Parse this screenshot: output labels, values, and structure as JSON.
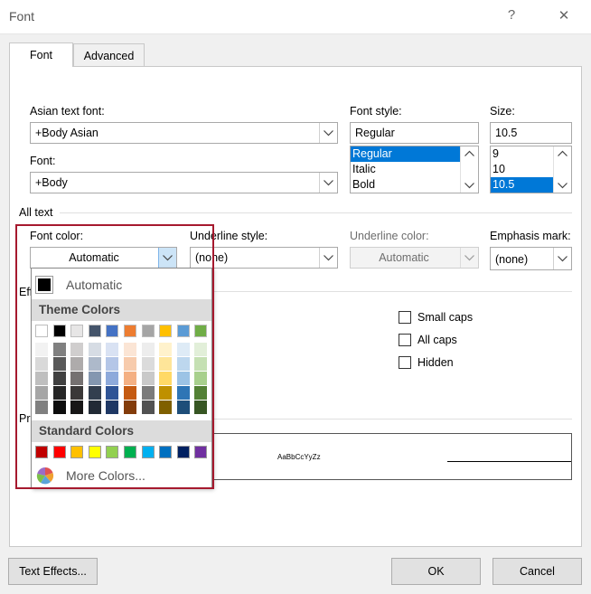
{
  "window": {
    "title": "Font",
    "help": "?",
    "close": "✕"
  },
  "tabs": [
    {
      "label": "Font",
      "active": true
    },
    {
      "label": "Advanced",
      "active": false
    }
  ],
  "asian_font": {
    "label": "Asian text font:",
    "value": "+Body Asian"
  },
  "font": {
    "label": "Font:",
    "value": "+Body"
  },
  "font_style": {
    "label": "Font style:",
    "value": "Regular",
    "options": [
      "Regular",
      "Italic",
      "Bold"
    ],
    "selected": "Regular"
  },
  "size": {
    "label": "Size:",
    "value": "10.5",
    "options": [
      "9",
      "10",
      "10.5"
    ],
    "selected": "10.5"
  },
  "all_text": {
    "label": "All text",
    "font_color": {
      "label": "Font color:",
      "value": "Automatic"
    },
    "underline_style": {
      "label": "Underline style:",
      "value": "(none)"
    },
    "underline_color": {
      "label": "Underline color:",
      "value": "Automatic",
      "disabled": true
    },
    "emphasis_mark": {
      "label": "Emphasis mark:",
      "value": "(none)"
    }
  },
  "effects": {
    "label_fragment": "Eff",
    "checkboxes": [
      {
        "label": "Small caps",
        "checked": false
      },
      {
        "label": "All caps",
        "checked": false
      },
      {
        "label": "Hidden",
        "checked": false
      }
    ]
  },
  "preview": {
    "label_fragment": "Pr",
    "sample": "AaBbCcYyZz"
  },
  "color_popup": {
    "automatic": "Automatic",
    "theme_header": "Theme Colors",
    "standard_header": "Standard Colors",
    "more_colors": "More Colors...",
    "theme_colors": [
      "#ffffff",
      "#000000",
      "#e7e6e6",
      "#44546a",
      "#4472c4",
      "#ed7d31",
      "#a5a5a5",
      "#ffc000",
      "#5b9bd5",
      "#70ad47"
    ],
    "theme_shades": [
      [
        "#f2f2f2",
        "#d9d9d9",
        "#bfbfbf",
        "#a6a6a6",
        "#808080"
      ],
      [
        "#808080",
        "#595959",
        "#404040",
        "#262626",
        "#0d0d0d"
      ],
      [
        "#d0cece",
        "#aeabab",
        "#757171",
        "#3a3838",
        "#171616"
      ],
      [
        "#d6dce4",
        "#adb9ca",
        "#8497b0",
        "#333f4f",
        "#222a35"
      ],
      [
        "#d9e2f3",
        "#b4c6e7",
        "#8eaadb",
        "#2f5496",
        "#1f3864"
      ],
      [
        "#fbe5d5",
        "#f7cbac",
        "#f4b083",
        "#c55a11",
        "#833c0b"
      ],
      [
        "#ededed",
        "#dbdbdb",
        "#c9c9c9",
        "#7b7b7b",
        "#525252"
      ],
      [
        "#fff2cc",
        "#fee599",
        "#ffd965",
        "#bf9000",
        "#7f6000"
      ],
      [
        "#deebf6",
        "#bdd7ee",
        "#9cc3e5",
        "#2e75b5",
        "#1e4e79"
      ],
      [
        "#e2efd9",
        "#c5e0b3",
        "#a8d08d",
        "#538135",
        "#375623"
      ]
    ],
    "standard_colors": [
      "#c00000",
      "#ff0000",
      "#ffc000",
      "#ffff00",
      "#92d050",
      "#00b050",
      "#00b0f0",
      "#0070c0",
      "#002060",
      "#7030a0"
    ]
  },
  "buttons": {
    "text_effects": "Text Effects...",
    "ok": "OK",
    "cancel": "Cancel"
  }
}
